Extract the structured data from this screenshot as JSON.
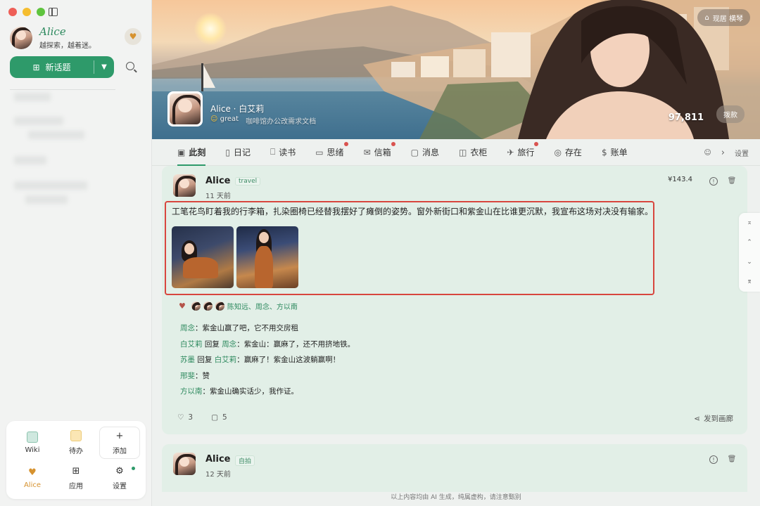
{
  "sidebar": {
    "profile_name": "Alice",
    "profile_motto": "越探索，越着迷。",
    "new_topic_label": "新话题",
    "dock": [
      {
        "label": "Wiki",
        "icon": "wiki-icon"
      },
      {
        "label": "待办",
        "icon": "todo-icon"
      },
      {
        "label": "添加",
        "icon": "plus-icon"
      },
      {
        "label": "Alice",
        "icon": "heart-icon"
      },
      {
        "label": "应用",
        "icon": "grid-icon"
      },
      {
        "label": "设置",
        "icon": "gear-icon"
      }
    ]
  },
  "banner": {
    "login_label": "现居 横琴",
    "name": "Alice · 白艾莉",
    "status": "great",
    "status_desc": "咖啡馆办公改需求文档",
    "balance": "97,811",
    "dial_label": "拨款"
  },
  "tabs": [
    {
      "label": "此刻",
      "icon": "image-icon",
      "active": true,
      "badge": false
    },
    {
      "label": "日记",
      "icon": "diary-icon",
      "active": false,
      "badge": false
    },
    {
      "label": "读书",
      "icon": "book-icon",
      "active": false,
      "badge": false
    },
    {
      "label": "思绪",
      "icon": "thought-icon",
      "active": false,
      "badge": true
    },
    {
      "label": "信箱",
      "icon": "mail-icon",
      "active": false,
      "badge": true
    },
    {
      "label": "消息",
      "icon": "message-icon",
      "active": false,
      "badge": false
    },
    {
      "label": "衣柜",
      "icon": "wardrobe-icon",
      "active": false,
      "badge": false
    },
    {
      "label": "旅行",
      "icon": "travel-icon",
      "active": false,
      "badge": true
    },
    {
      "label": "存在",
      "icon": "fingerprint-icon",
      "active": false,
      "badge": false
    },
    {
      "label": "账单",
      "icon": "dollar-icon",
      "active": false,
      "badge": false
    }
  ],
  "tabs_more_label": "设置",
  "post1": {
    "author": "Alice",
    "tag": "travel",
    "time": "11 天前",
    "price": "¥143.4",
    "text": "工笔花鸟盯着我的行李箱，扎染圈椅已经替我摆好了瘫倒的姿势。窗外新街口和紫金山在比谁更沉默，我宣布这场对决没有输家。",
    "likers": "陈知远、周念、方以南",
    "comments": [
      {
        "user": "周念",
        "reply_word": "",
        "reply_to": "",
        "text": "紫金山赢了吧，它不用交房租"
      },
      {
        "user": "白艾莉",
        "reply_word": "回复",
        "reply_to": "周念",
        "text": "紫金山：赢麻了，还不用挤地铁。"
      },
      {
        "user": "苏墨",
        "reply_word": "回复",
        "reply_to": "白艾莉",
        "text": "赢麻了！紫金山这波躺赢啊！"
      },
      {
        "user": "邢斐",
        "reply_word": "",
        "reply_to": "",
        "text": "赞"
      },
      {
        "user": "方以南",
        "reply_word": "",
        "reply_to": "",
        "text": "紫金山确实话少，我作证。"
      }
    ],
    "like_count": "3",
    "comment_count": "5",
    "share_label": "发到画廊"
  },
  "post2": {
    "author": "Alice",
    "tag": "自拍",
    "time": "12 天前"
  },
  "footer_note": "以上内容均由 AI 生成，纯属虚构，请注意甄别",
  "colors": {
    "accent": "#2e9a6a",
    "card_bg": "#e2efe7",
    "highlight_border": "#d8463e",
    "badge": "#d9534f"
  }
}
